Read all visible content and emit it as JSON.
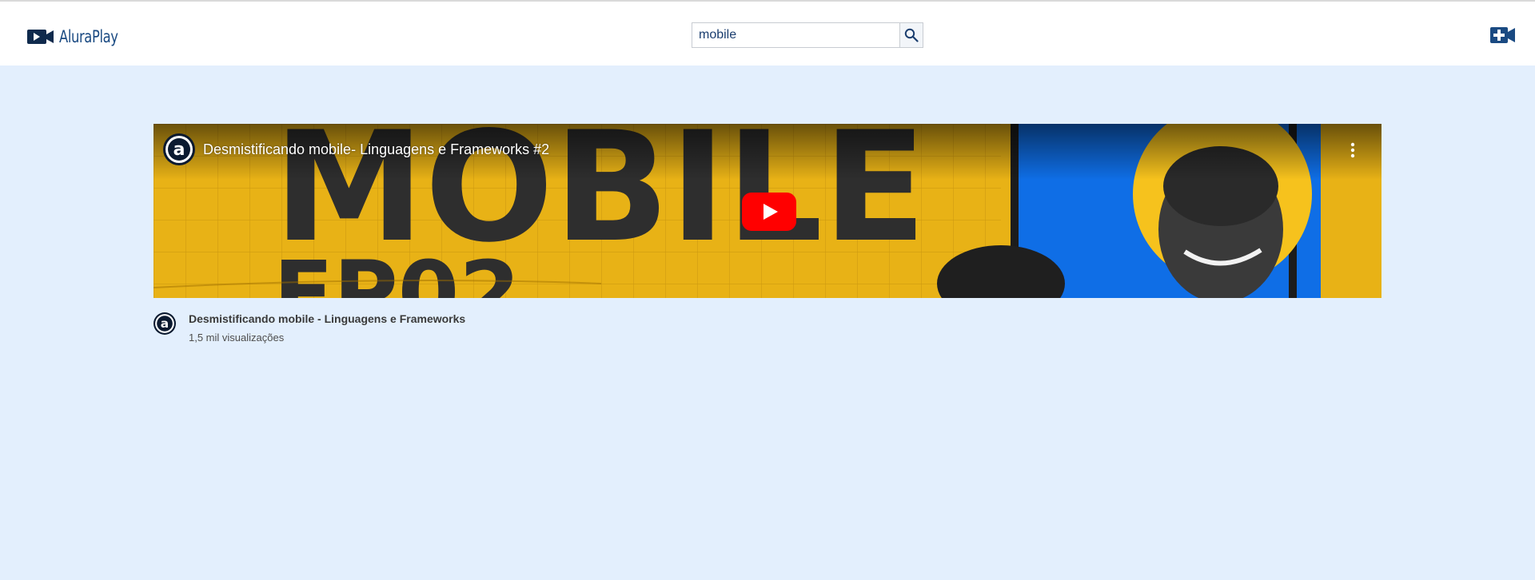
{
  "header": {
    "logo_text": "AluraPlay",
    "search": {
      "value": "mobile",
      "placeholder": ""
    },
    "icons": {
      "logo": "video-camera-icon",
      "search": "search-icon",
      "upload": "add-video-icon"
    }
  },
  "video": {
    "player_title": "Desmistificando mobile- Linguagens e Frameworks #2",
    "card_title": "Desmistificando mobile - Linguagens e Frameworks",
    "views": "1,5 mil visualizações",
    "channel_avatar_letter": "a",
    "thumbnail_text": {
      "big": "MOBILE",
      "sub": "EP02"
    },
    "icons": {
      "play": "play-icon",
      "menu": "more-vertical-icon",
      "avatar": "alura-logo-icon"
    }
  },
  "colors": {
    "page_background": "#e3effd",
    "header_background": "#ffffff",
    "brand": "#1a4a82",
    "thumbnail_yellow": "#e8b216",
    "thumbnail_blue": "#0f6ee6",
    "play_red": "#ff0000"
  }
}
